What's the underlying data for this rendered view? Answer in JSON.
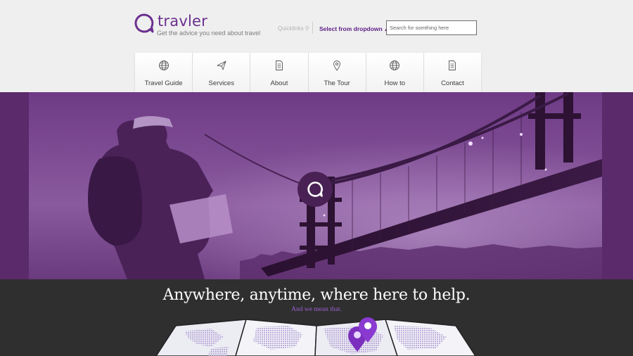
{
  "brand": {
    "name": "travler",
    "tagline": "Get the advice you need about travel",
    "accent": "#6b2f8f"
  },
  "topbar": {
    "quicklinks_label": "Quicklinks",
    "select_label": "Select from dropdown",
    "search_placeholder": "Search for somthing here"
  },
  "nav": {
    "items": [
      {
        "label": "Travel Guide",
        "icon": "globe-icon"
      },
      {
        "label": "Services",
        "icon": "paper-plane-icon"
      },
      {
        "label": "About",
        "icon": "document-icon"
      },
      {
        "label": "The Tour",
        "icon": "map-pin-icon"
      },
      {
        "label": "How to",
        "icon": "globe-icon"
      },
      {
        "label": "Contact",
        "icon": "document-icon"
      }
    ],
    "underline_color": "#6a2f94"
  },
  "hero": {
    "tint": "#6b2f7d",
    "badge_icon": "speech-bubble-icon"
  },
  "band": {
    "headline": "Anywhere, anytime, where here to help.",
    "subline": "And we mean that.",
    "subline_color": "#9b5fd2"
  },
  "map": {
    "pin_color": "#7b2fbf",
    "icon": "map-pin-icon"
  }
}
